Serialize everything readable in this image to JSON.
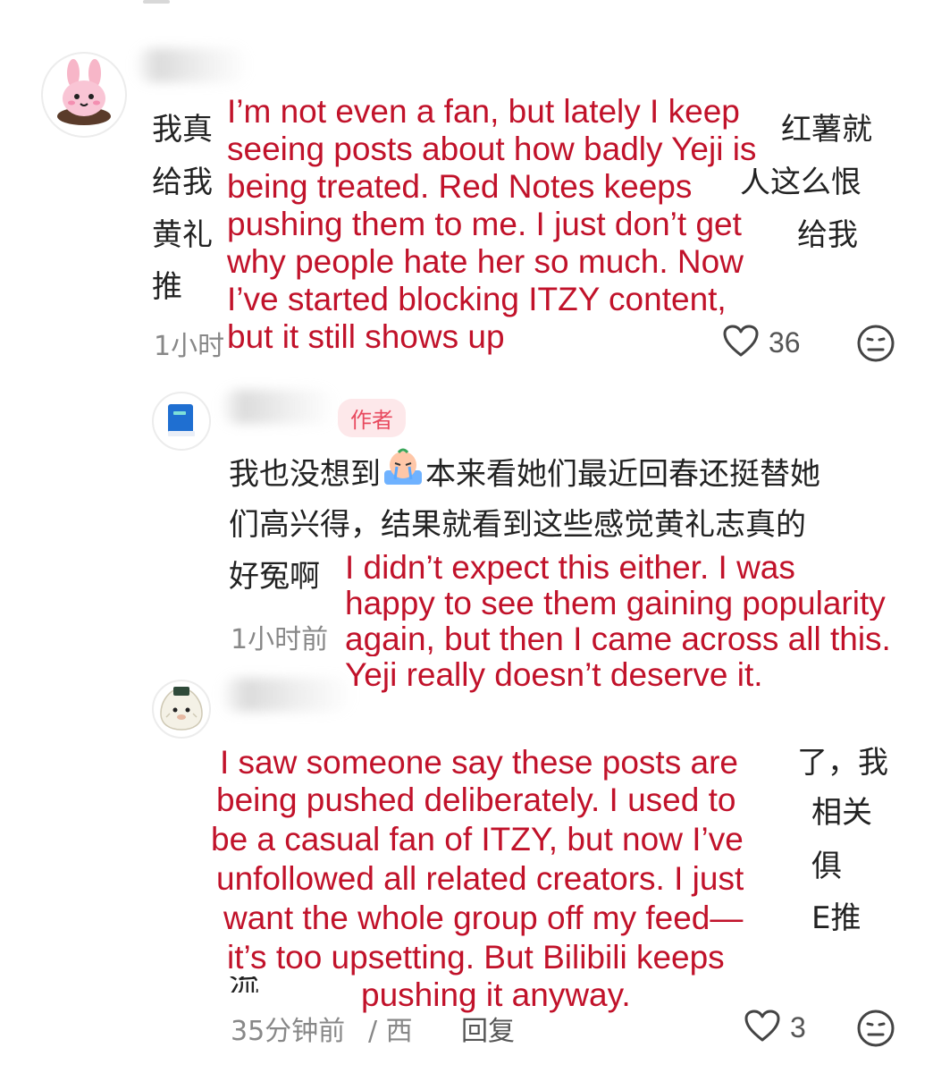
{
  "comments": [
    {
      "avatar_icon": "bunny-avatar-icon",
      "text_lines": [
        "我真",
        "给我",
        "黄礼",
        "推"
      ],
      "right_fragments": [
        "红薯就",
        "人这么恨",
        "给我"
      ],
      "translation": [
        "I’m not even a fan, but lately I keep",
        "seeing posts about how badly Yeji is",
        "being treated. Red Notes keeps",
        "pushing them to me. I just don’t get",
        " why people hate her so much. Now",
        "I’ve started blocking ITZY content,",
        "but it still shows up"
      ],
      "time": "1小时",
      "likes": "36"
    },
    {
      "avatar_icon": "blue-book-avatar-icon",
      "author_badge": "作者",
      "text_lines": [
        "我也没想到",
        "本来看她们最近回春还挺替她",
        "们高兴得，结果就看到这些感觉黄礼志真的",
        "好冤啊"
      ],
      "translation": [
        "I didn’t expect this either. I was",
        "happy to see them gaining popularity",
        "again, but then I came across all this.",
        "Yeji really doesn’t deserve it."
      ],
      "time": "1小时前"
    },
    {
      "avatar_icon": "rice-ball-avatar-icon",
      "right_fragments": [
        "了，我",
        "相关",
        "俱",
        "E推"
      ],
      "left_fragment": "流",
      "translation": [
        "I saw someone say these posts are",
        "being pushed deliberately. I used to",
        "be a casual fan of ITZY, but now I’ve",
        "unfollowed all related creators. I just",
        "want the whole group off my feed—",
        "it’s too upsetting. But Bilibili keeps",
        "pushing it anyway."
      ],
      "time": "35分钟前",
      "location_fragment": "/ 西",
      "reply_label": "回复",
      "likes": "3"
    }
  ],
  "colors": {
    "translation_red": "#c1122a",
    "meta_gray": "#888888",
    "badge_bg": "#fde8ea",
    "badge_text": "#e84a5f"
  }
}
